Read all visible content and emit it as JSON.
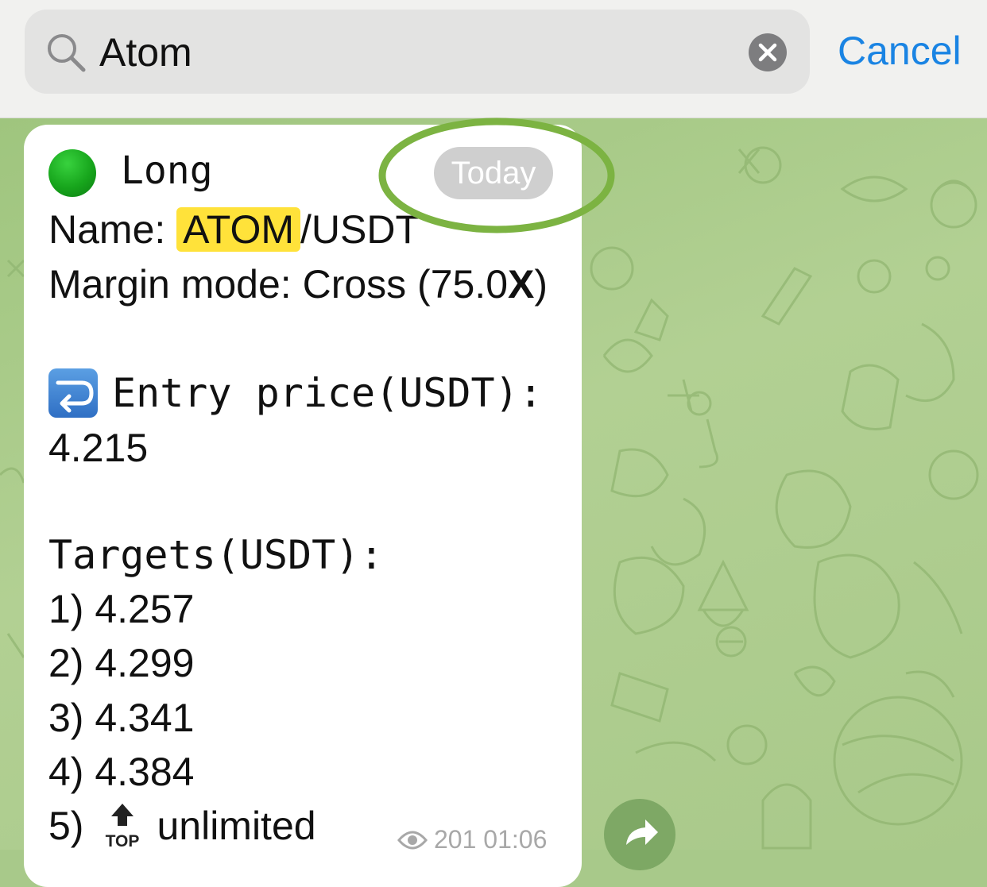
{
  "search": {
    "query": "Atom",
    "cancel_label": "Cancel"
  },
  "message": {
    "direction_emoji": "green-circle",
    "direction": "Long",
    "date_badge": "Today",
    "name_label": "Name: ",
    "name_highlight": "ATOM",
    "name_rest": "/USDT",
    "margin_prefix": "Margin mode: Cross (75.0",
    "margin_bold": "X",
    "margin_suffix": ")",
    "entry_label": "Entry price(USDT):",
    "entry_value": "4.215",
    "targets_label": "Targets(USDT):",
    "targets": [
      "1) 4.257",
      "2) 4.299",
      "3) 4.341",
      "4) 4.384"
    ],
    "target5_prefix": "5)",
    "target5_emoji": "TOP",
    "target5_value": "unlimited",
    "views": "201",
    "time": "01:06"
  },
  "colors": {
    "accent": "#1a84e3",
    "highlight": "#ffe23a",
    "annotation_ring": "#7cb342"
  }
}
